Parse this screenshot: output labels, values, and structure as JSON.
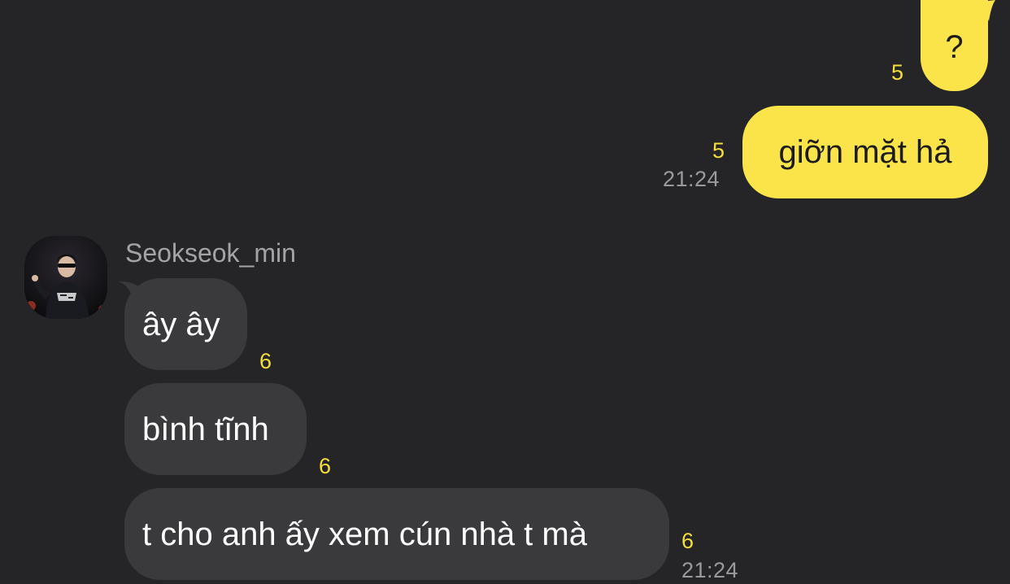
{
  "conversation": {
    "outgoing": [
      {
        "text": "?",
        "unread": "5",
        "time": ""
      },
      {
        "text": "giỡn mặt hả",
        "unread": "5",
        "time": "21:24"
      }
    ],
    "incoming_group": {
      "sender_name": "Seokseok_min",
      "avatar_icon": "user-photo-avatar",
      "messages": [
        {
          "text": "ây ây",
          "unread": "6",
          "time": ""
        },
        {
          "text": "bình tĩnh",
          "unread": "6",
          "time": ""
        },
        {
          "text": "t cho anh ấy xem cún nhà t mà",
          "unread": "6",
          "time": "21:24"
        }
      ]
    }
  },
  "colors": {
    "background": "#252527",
    "outgoing_bubble": "#fbe44a",
    "incoming_bubble": "#3a3a3d",
    "unread_count": "#f6de3c",
    "timestamp": "#9a9a9d"
  }
}
